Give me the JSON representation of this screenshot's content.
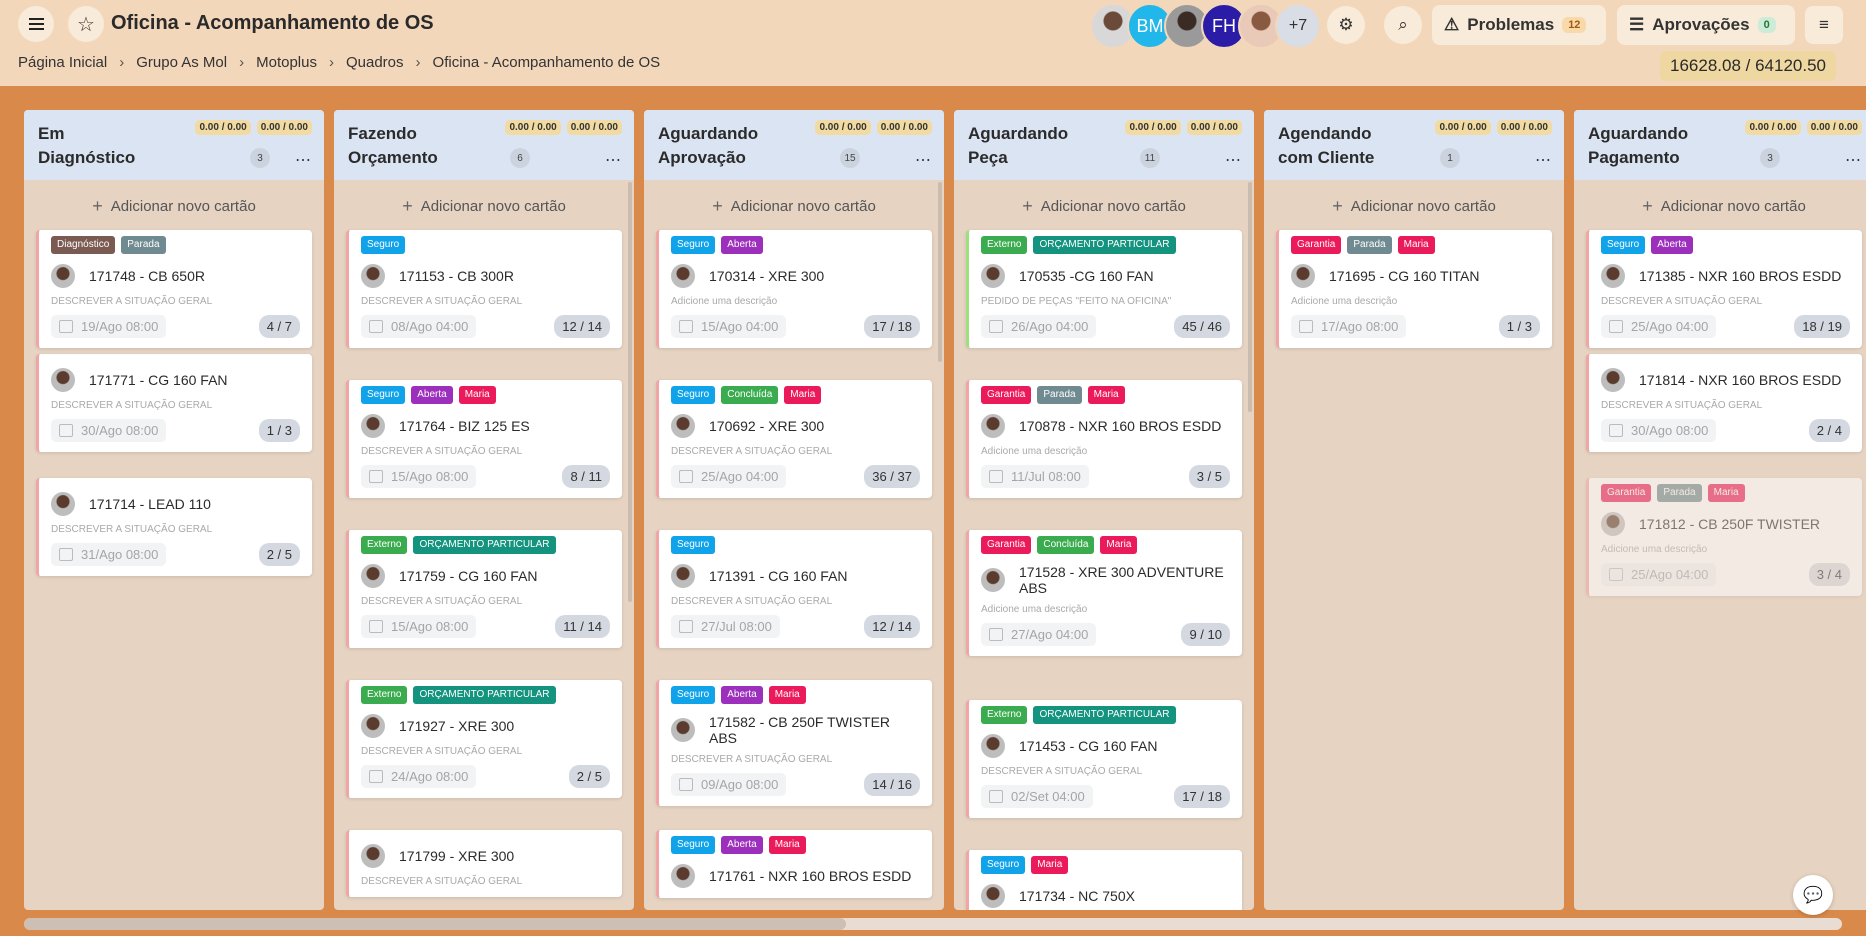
{
  "header": {
    "title": "Oficina - Acompanhamento de OS",
    "breadcrumbs": [
      "Página Inicial",
      "Grupo As Mol",
      "Motoplus",
      "Quadros",
      "Oficina - Acompanhamento de OS"
    ],
    "avatars": {
      "bm": "BM",
      "fh": "FH",
      "more": "+7"
    },
    "problems": {
      "label": "Problemas",
      "count": "12"
    },
    "approvals": {
      "label": "Aprovações",
      "count": "0"
    },
    "total": "16628.08 / 64120.50"
  },
  "add_label": "Adicionar novo cartão",
  "amount": "0.00 / 0.00",
  "columns": [
    {
      "name": "Em Diagnóstico",
      "count": "3"
    },
    {
      "name": "Fazendo Orçamento",
      "count": "6"
    },
    {
      "name": "Aguardando Aprovação",
      "count": "15"
    },
    {
      "name": "Aguardando Peça",
      "count": "11"
    },
    {
      "name": "Agendando com Cliente",
      "count": "1"
    },
    {
      "name": "Aguardando Pagamento",
      "count": "3"
    }
  ],
  "cards": {
    "c0": [
      {
        "tags": [
          "Diagnóstico",
          "Parada"
        ],
        "title": "171748 - CB 650R",
        "desc": "DESCREVER A SITUAÇÃO GERAL",
        "date": "19/Ago 08:00",
        "progress": "4 / 7"
      },
      {
        "tags": [],
        "title": "171771 - CG 160 FAN",
        "desc": "DESCREVER A SITUAÇÃO GERAL",
        "date": "30/Ago 08:00",
        "progress": "1 / 3"
      },
      {
        "tags": [],
        "title": "171714 - LEAD 110",
        "desc": "DESCREVER A SITUAÇÃO GERAL",
        "date": "31/Ago 08:00",
        "progress": "2 / 5"
      }
    ],
    "c1": [
      {
        "tags": [
          "Seguro"
        ],
        "title": "171153 - CB 300R",
        "desc": "DESCREVER A SITUAÇÃO GERAL",
        "date": "08/Ago 04:00",
        "progress": "12 / 14"
      },
      {
        "tags": [
          "Seguro",
          "Aberta",
          "Maria"
        ],
        "title": "171764 - BIZ 125 ES",
        "desc": "DESCREVER A SITUAÇÃO GERAL",
        "date": "15/Ago 08:00",
        "progress": "8 / 11"
      },
      {
        "tags": [
          "Externo",
          "ORÇAMENTO PARTICULAR"
        ],
        "title": "171759 - CG 160 FAN",
        "desc": "DESCREVER A SITUAÇÃO GERAL",
        "date": "15/Ago 08:00",
        "progress": "11 / 14"
      },
      {
        "tags": [
          "Externo",
          "ORÇAMENTO PARTICULAR"
        ],
        "title": "171927 - XRE 300",
        "desc": "DESCREVER A SITUAÇÃO GERAL",
        "date": "24/Ago 08:00",
        "progress": "2 / 5"
      },
      {
        "tags": [],
        "title": "171799 - XRE 300",
        "desc": "DESCREVER A SITUAÇÃO GERAL",
        "date": "",
        "progress": ""
      }
    ],
    "c2": [
      {
        "tags": [
          "Seguro",
          "Aberta"
        ],
        "title": "170314 - XRE 300",
        "desc": "Adicione uma descrição",
        "date": "15/Ago 04:00",
        "progress": "17 / 18"
      },
      {
        "tags": [
          "Seguro",
          "Concluída",
          "Maria"
        ],
        "title": "170692 - XRE 300",
        "desc": "DESCREVER A SITUAÇÃO GERAL",
        "date": "25/Ago 04:00",
        "progress": "36 / 37"
      },
      {
        "tags": [
          "Seguro"
        ],
        "title": "171391 - CG 160 FAN",
        "desc": "DESCREVER A SITUAÇÃO GERAL",
        "date": "27/Jul 08:00",
        "progress": "12 / 14"
      },
      {
        "tags": [
          "Seguro",
          "Aberta",
          "Maria"
        ],
        "title": "171582 - CB 250F TWISTER ABS",
        "desc": "DESCREVER A SITUAÇÃO GERAL",
        "date": "09/Ago 08:00",
        "progress": "14 / 16"
      },
      {
        "tags": [
          "Seguro",
          "Aberta",
          "Maria"
        ],
        "title": "171761 - NXR 160 BROS ESDD",
        "desc": "",
        "date": "",
        "progress": ""
      }
    ],
    "c3": [
      {
        "tags": [
          "Externo",
          "ORÇAMENTO PARTICULAR"
        ],
        "title": "170535 -CG 160 FAN",
        "desc": "PEDIDO DE PEÇAS \"FEITO NA OFICINA\"",
        "date": "26/Ago 04:00",
        "progress": "45 / 46"
      },
      {
        "tags": [
          "Garantia",
          "Parada",
          "Maria"
        ],
        "title": "170878 - NXR 160 BROS ESDD",
        "desc": "Adicione uma descrição",
        "date": "11/Jul 08:00",
        "progress": "3 / 5"
      },
      {
        "tags": [
          "Garantia",
          "Concluída",
          "Maria"
        ],
        "title": "171528 - XRE 300 ADVENTURE ABS",
        "desc": "Adicione uma descrição",
        "date": "27/Ago 04:00",
        "progress": "9 / 10"
      },
      {
        "tags": [
          "Externo",
          "ORÇAMENTO PARTICULAR"
        ],
        "title": "171453 - CG 160 FAN",
        "desc": "DESCREVER A SITUAÇÃO GERAL",
        "date": "02/Set 04:00",
        "progress": "17 / 18"
      },
      {
        "tags": [
          "Seguro",
          "Maria"
        ],
        "title": "171734 - NC 750X",
        "desc": "",
        "date": "",
        "progress": ""
      }
    ],
    "c4": [
      {
        "tags": [
          "Garantia",
          "Parada",
          "Maria"
        ],
        "title": "171695 - CG 160 TITAN",
        "desc": "Adicione uma descrição",
        "date": "17/Ago 08:00",
        "progress": "1 / 3"
      }
    ],
    "c5": [
      {
        "tags": [
          "Seguro",
          "Aberta"
        ],
        "title": "171385 - NXR 160 BROS ESDD",
        "desc": "DESCREVER A SITUAÇÃO GERAL",
        "date": "25/Ago 04:00",
        "progress": "18 / 19"
      },
      {
        "tags": [],
        "title": "171814 - NXR 160 BROS ESDD",
        "desc": "DESCREVER A SITUAÇÃO GERAL",
        "date": "30/Ago 08:00",
        "progress": "2 / 4"
      },
      {
        "tags": [
          "Garantia",
          "Parada",
          "Maria"
        ],
        "title": "171812 - CB 250F TWISTER",
        "desc": "Adicione uma descrição",
        "date": "25/Ago 04:00",
        "progress": "3 / 4"
      }
    ]
  }
}
